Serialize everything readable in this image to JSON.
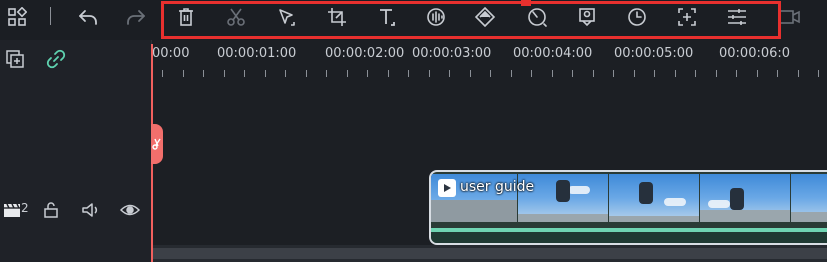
{
  "toolbar": {
    "buttons": [
      {
        "name": "layout-icon"
      },
      {
        "name": "undo-icon"
      },
      {
        "name": "redo-icon"
      },
      {
        "name": "delete-icon"
      },
      {
        "name": "cut-icon"
      },
      {
        "name": "select-tool-icon"
      },
      {
        "name": "crop-icon"
      },
      {
        "name": "text-icon"
      },
      {
        "name": "audio-icon"
      },
      {
        "name": "color-icon"
      },
      {
        "name": "speed-icon"
      },
      {
        "name": "stabilize-icon"
      },
      {
        "name": "duration-icon"
      },
      {
        "name": "zoom-icon"
      },
      {
        "name": "adjust-icon"
      },
      {
        "name": "record-icon"
      }
    ],
    "highlight_color": "#e8302e"
  },
  "left_panel": {
    "add_track_icon": "add-track-icon",
    "link_icon": "link-icon",
    "track_number": "2",
    "track_icons": [
      "video-track-icon",
      "lock-icon",
      "volume-icon",
      "eye-icon"
    ]
  },
  "ruler": {
    "labels": [
      "00:00",
      "00:00:01:00",
      "00:00:02:00",
      "00:00:03:00",
      "00:00:04:00",
      "00:00:05:00",
      "00:00:06:0"
    ]
  },
  "clip": {
    "title": "user guide",
    "strip_color": "#6fd5b3"
  },
  "colors": {
    "playhead": "#f1605e",
    "accent": "#5fd3b0",
    "background": "#1c1f24"
  }
}
